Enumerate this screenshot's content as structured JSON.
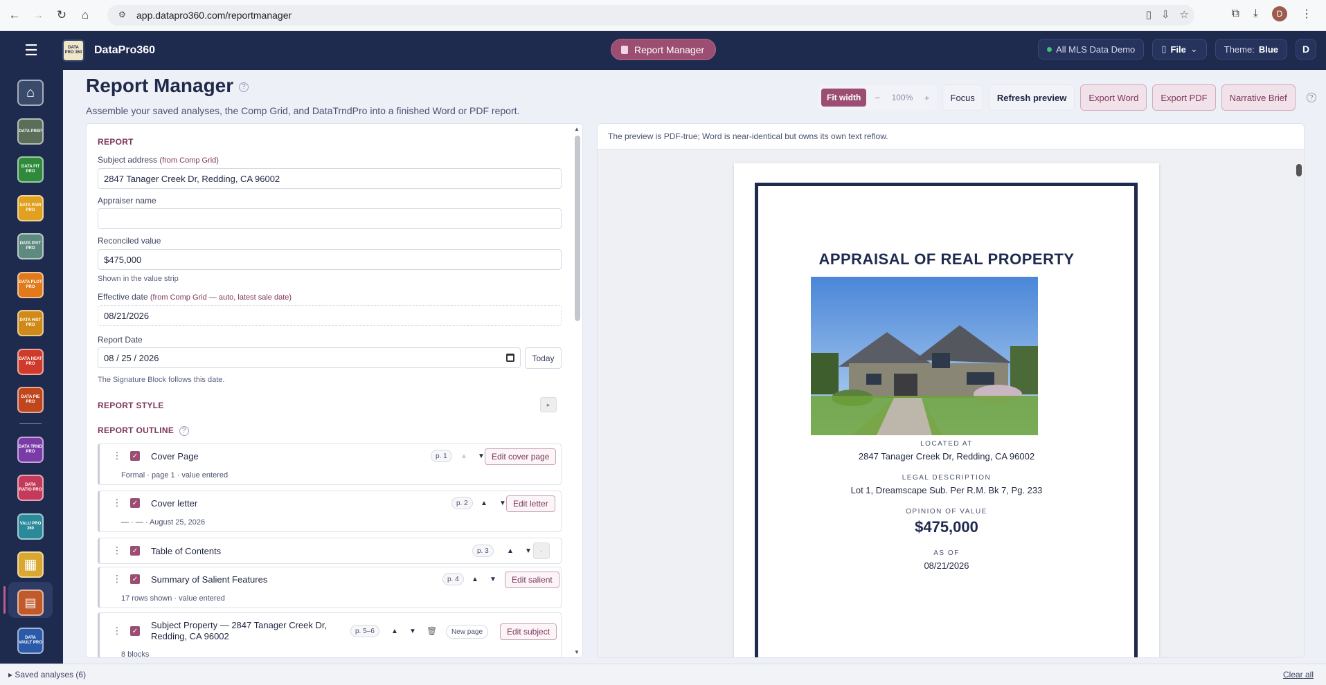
{
  "browser": {
    "url": "app.datapro360.com/reportmanager",
    "profile_initial": "D"
  },
  "header": {
    "brand_logo_text": "DATA PRO 360",
    "brand_name": "DataPro360",
    "center_label": "Report Manager",
    "mls_label": "All MLS Data Demo",
    "file_label": "File",
    "theme_label": "Theme:",
    "theme_value": "Blue",
    "avatar": "D"
  },
  "rail": [
    {
      "label": "",
      "color": "#3a4a6a",
      "name": "home"
    },
    {
      "label": "DATA PREP",
      "color": "#5a6e5a"
    },
    {
      "label": "DATA FIT PRO",
      "color": "#2f8a3c"
    },
    {
      "label": "DATA PAIR PRO",
      "color": "#e0a020"
    },
    {
      "label": "DATA PIVT PRO",
      "color": "#5e8a80"
    },
    {
      "label": "DATA PLOT PRO",
      "color": "#e07a1a"
    },
    {
      "label": "DATA HIST PRO",
      "color": "#d08a1a"
    },
    {
      "label": "DATA HEAT PRO",
      "color": "#d03a2a"
    },
    {
      "label": "DATA PIE PRO",
      "color": "#c0461e"
    },
    {
      "label": "DATA TRND PRO",
      "color": "#7a3aa8"
    },
    {
      "label": "DATA RATIO PRO",
      "color": "#c43a5a"
    },
    {
      "label": "VALU PRO 360",
      "color": "#2a8a9a"
    },
    {
      "label": "",
      "color": "#d8a830",
      "name": "grid"
    },
    {
      "label": "",
      "color": "#c05a2a",
      "name": "report"
    },
    {
      "label": "DATA VAULT PRO",
      "color": "#2a5aa8"
    }
  ],
  "page": {
    "title": "Report Manager",
    "subtitle": "Assemble your saved analyses, the Comp Grid, and DataTrndPro into a finished Word or PDF report."
  },
  "toolbar": {
    "fit_width": "Fit width",
    "zoom_minus": "−",
    "zoom_value": "100%",
    "zoom_plus": "+",
    "focus": "Focus",
    "refresh": "Refresh preview",
    "export_word": "Export Word",
    "export_pdf": "Export PDF",
    "narrative_brief": "Narrative Brief"
  },
  "form": {
    "section_report": "REPORT",
    "subject_label": "Subject address",
    "subject_hint": "(from Comp Grid)",
    "subject_value": "2847 Tanager Creek Dr, Redding, CA 96002",
    "appraiser_label": "Appraiser name",
    "appraiser_value": "",
    "reconciled_label": "Reconciled value",
    "reconciled_value": "$475,000",
    "reconciled_note": "Shown in the value strip",
    "effective_label": "Effective date",
    "effective_hint": "(from Comp Grid — auto, latest sale date)",
    "effective_value": "08/21/2026",
    "report_date_label": "Report Date",
    "report_date_value": "08 / 25 / 2026",
    "today": "Today",
    "report_date_note": "The Signature Block follows this date.",
    "section_style": "REPORT STYLE",
    "section_outline": "REPORT OUTLINE"
  },
  "outline": [
    {
      "title": "Cover Page",
      "sub": "Formal · page 1 · value entered",
      "page": "p. 1",
      "action": "Edit cover page"
    },
    {
      "title": "Cover letter",
      "sub": "— · — · August 25, 2026",
      "page": "p. 2",
      "action": "Edit letter"
    },
    {
      "title": "Table of Contents",
      "sub": "",
      "page": "p. 3",
      "action": "·"
    },
    {
      "title": "Summary of Salient Features",
      "sub": "17 rows shown · value entered",
      "page": "p. 4",
      "action": "Edit salient"
    },
    {
      "title": "Subject Property — 2847 Tanager Creek Dr,",
      "title2": "Redding, CA 96002",
      "sub": "8 blocks",
      "page": "p. 5–6",
      "extra": "New page",
      "action": "Edit subject"
    }
  ],
  "preview": {
    "note": "The preview is PDF-true; Word is near-identical but owns its own text reflow.",
    "doc_title": "APPRAISAL OF REAL PROPERTY",
    "located_label": "LOCATED AT",
    "located_value": "2847 Tanager Creek Dr, Redding, CA 96002",
    "legal_label": "LEGAL DESCRIPTION",
    "legal_value": "Lot 1, Dreamscape Sub. Per R.M. Bk 7, Pg. 233",
    "opinion_label": "OPINION OF VALUE",
    "opinion_value": "$475,000",
    "asof_label": "AS OF",
    "asof_value": "08/21/2026"
  },
  "footer": {
    "saved": "Saved analyses (6)",
    "clear": "Clear all"
  }
}
